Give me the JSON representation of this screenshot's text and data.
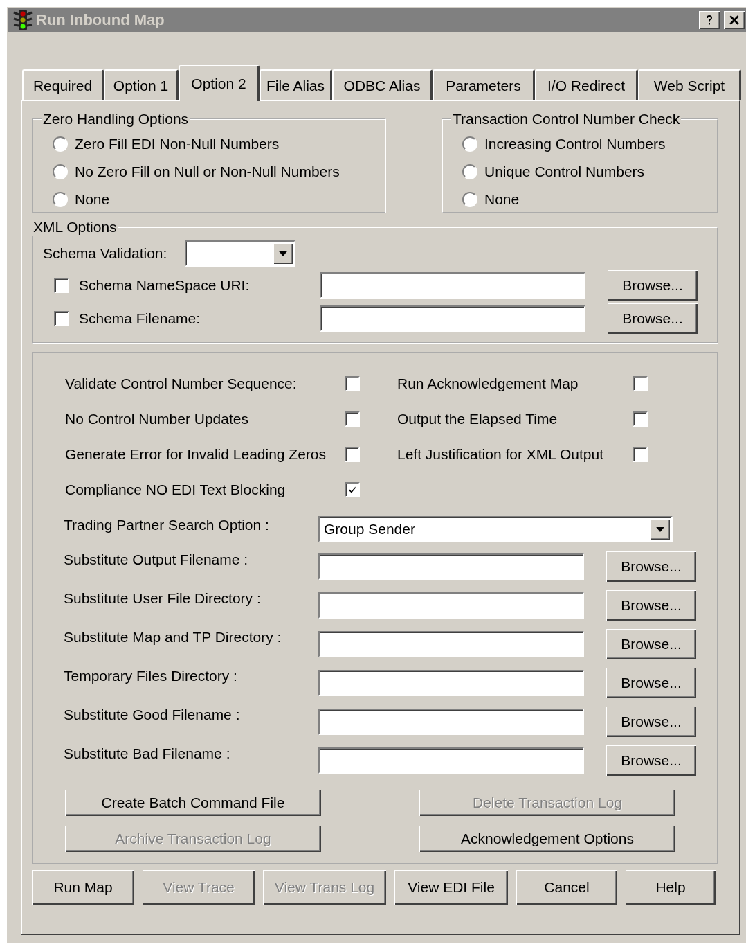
{
  "window": {
    "title": "Run Inbound Map"
  },
  "tabs": [
    {
      "label": "Required",
      "selected": false
    },
    {
      "label": "Option 1",
      "selected": false
    },
    {
      "label": "Option 2",
      "selected": true
    },
    {
      "label": "File Alias",
      "selected": false
    },
    {
      "label": "ODBC Alias",
      "selected": false
    },
    {
      "label": "Parameters",
      "selected": false
    },
    {
      "label": "I/O Redirect",
      "selected": false
    },
    {
      "label": "Web Script",
      "selected": false
    }
  ],
  "zero_handling": {
    "title": "Zero Handling Options",
    "options": [
      {
        "label": "Zero Fill EDI Non-Null Numbers",
        "selected": false
      },
      {
        "label": "No Zero Fill on Null or Non-Null Numbers",
        "selected": false
      },
      {
        "label": "None",
        "selected": false
      }
    ]
  },
  "control_number_check": {
    "title": "Transaction Control Number Check",
    "options": [
      {
        "label": "Increasing Control Numbers",
        "selected": false
      },
      {
        "label": "Unique Control Numbers",
        "selected": false
      },
      {
        "label": "None",
        "selected": false
      }
    ]
  },
  "xml_options": {
    "title": "XML Options",
    "schema_validation": {
      "label": "Schema Validation:"
    },
    "fields": [
      {
        "label": "Schema NameSpace URI:",
        "checked": false,
        "button": "Browse..."
      },
      {
        "label": "Schema Filename:",
        "checked": false,
        "button": "Browse..."
      }
    ]
  },
  "flags_left": [
    {
      "label": "Validate Control Number Sequence:",
      "checked": false
    },
    {
      "label": "No Control Number Updates",
      "checked": false
    },
    {
      "label": "Generate Error for Invalid Leading Zeros",
      "checked": false
    },
    {
      "label": "Compliance NO EDI Text Blocking",
      "checked": true
    }
  ],
  "flags_right": [
    {
      "label": "Run Acknowledgement  Map",
      "checked": false
    },
    {
      "label": "Output the Elapsed Time",
      "checked": false
    },
    {
      "label": "Left Justification for XML Output",
      "checked": false
    }
  ],
  "trading_partner": {
    "label": "Trading Partner Search Option :",
    "value": "Group Sender"
  },
  "path_fields": [
    {
      "label": "Substitute Output Filename :",
      "button": "Browse..."
    },
    {
      "label": "Substitute User File Directory :",
      "button": "Browse..."
    },
    {
      "label": "Substitute Map and TP Directory :",
      "button": "Browse..."
    },
    {
      "label": "Temporary Files Directory :",
      "button": "Browse..."
    },
    {
      "label": "Substitute Good Filename :",
      "button": "Browse..."
    },
    {
      "label": "Substitute Bad Filename :",
      "button": "Browse..."
    }
  ],
  "action_buttons": [
    {
      "label": "Create Batch Command File",
      "disabled": false
    },
    {
      "label": "Delete Transaction Log",
      "disabled": true
    },
    {
      "label": "Archive Transaction Log",
      "disabled": true
    },
    {
      "label": "Acknowledgement Options",
      "disabled": false
    }
  ],
  "footer_buttons": [
    {
      "label": "Run Map",
      "disabled": false
    },
    {
      "label": "View Trace",
      "disabled": true
    },
    {
      "label": "View Trans Log",
      "disabled": true
    },
    {
      "label": "View EDI File",
      "disabled": false
    },
    {
      "label": "Cancel",
      "disabled": false
    },
    {
      "label": "Help",
      "disabled": false
    }
  ]
}
